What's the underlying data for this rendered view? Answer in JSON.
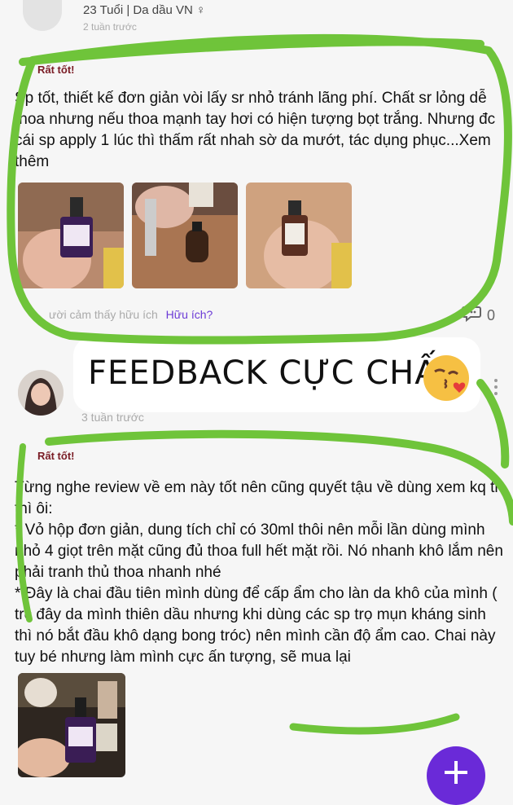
{
  "review1": {
    "user_meta": "23 Tuổi | Da dầu VN ♀",
    "time": "2 tuần trước",
    "rating": "Rất tốt!",
    "body": "Sp tốt, thiết kế đơn giản vòi lấy sr nhỏ tránh lãng phí. Chất sr lỏng dễ thoa nhưng nếu thoa mạnh tay hơi có hiện tượng bọt trắng. Nhưng đc cái sp apply 1 lúc thì thấm rất nhah sờ da mướt, tác dụng phục...Xem thêm",
    "helpful_text": "ười cảm thấy hữu ích",
    "helpful_link": "Hữu ích?",
    "comment_count": "0"
  },
  "banner": {
    "text": "FEEDBACK CỰC CHẤT"
  },
  "review2": {
    "time": "3 tuần trước",
    "rating": "Rất tốt!",
    "body": "Từng nghe review về em này tốt nên cũng quyết tậu về dùng xem kq tn thì ôi:\n* Vỏ hộp đơn giản, dung tích chỉ có 30ml thôi nên mỗi lần dùng mình nhỏ 4 giọt trên mặt cũng đủ thoa full hết mặt rồi. Nó nhanh khô lắm nên phải tranh thủ thoa nhanh nhé\n* Đây là chai đầu tiên mình dùng để cấp ẩm cho làn da khô của mình ( trc đây da mình thiên dầu nhưng khi dùng các sp trọ mụn kháng sinh thì nó bắt đầu khô dạng bong tróc) nên mình cần độ ẩm cao. Chai này tuy bé nhưng làm mình cực ấn tượng, sẽ mua lại"
  },
  "colors": {
    "accent_green": "#6fc43a",
    "rating_red": "#7a1c25",
    "link_purple": "#6b3ad6",
    "fab_purple": "#6a2ad8"
  },
  "icons": {
    "comment": "comment-bubble-icon",
    "more": "more-vertical-icon",
    "add": "plus-icon",
    "emoji": "kissing-face-emoji"
  }
}
